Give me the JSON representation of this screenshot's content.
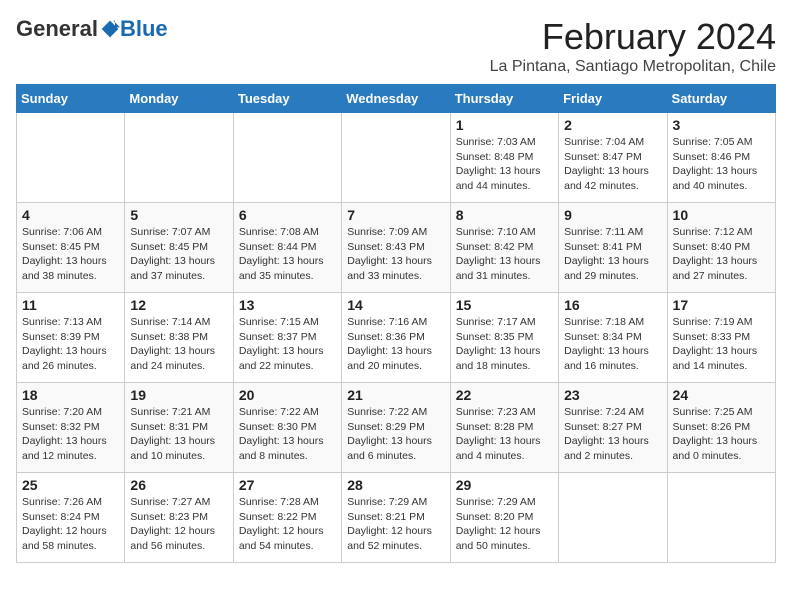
{
  "header": {
    "logo_general": "General",
    "logo_blue": "Blue",
    "title": "February 2024",
    "subtitle": "La Pintana, Santiago Metropolitan, Chile"
  },
  "weekdays": [
    "Sunday",
    "Monday",
    "Tuesday",
    "Wednesday",
    "Thursday",
    "Friday",
    "Saturday"
  ],
  "weeks": [
    [
      {
        "day": "",
        "info": ""
      },
      {
        "day": "",
        "info": ""
      },
      {
        "day": "",
        "info": ""
      },
      {
        "day": "",
        "info": ""
      },
      {
        "day": "1",
        "info": "Sunrise: 7:03 AM\nSunset: 8:48 PM\nDaylight: 13 hours and 44 minutes."
      },
      {
        "day": "2",
        "info": "Sunrise: 7:04 AM\nSunset: 8:47 PM\nDaylight: 13 hours and 42 minutes."
      },
      {
        "day": "3",
        "info": "Sunrise: 7:05 AM\nSunset: 8:46 PM\nDaylight: 13 hours and 40 minutes."
      }
    ],
    [
      {
        "day": "4",
        "info": "Sunrise: 7:06 AM\nSunset: 8:45 PM\nDaylight: 13 hours and 38 minutes."
      },
      {
        "day": "5",
        "info": "Sunrise: 7:07 AM\nSunset: 8:45 PM\nDaylight: 13 hours and 37 minutes."
      },
      {
        "day": "6",
        "info": "Sunrise: 7:08 AM\nSunset: 8:44 PM\nDaylight: 13 hours and 35 minutes."
      },
      {
        "day": "7",
        "info": "Sunrise: 7:09 AM\nSunset: 8:43 PM\nDaylight: 13 hours and 33 minutes."
      },
      {
        "day": "8",
        "info": "Sunrise: 7:10 AM\nSunset: 8:42 PM\nDaylight: 13 hours and 31 minutes."
      },
      {
        "day": "9",
        "info": "Sunrise: 7:11 AM\nSunset: 8:41 PM\nDaylight: 13 hours and 29 minutes."
      },
      {
        "day": "10",
        "info": "Sunrise: 7:12 AM\nSunset: 8:40 PM\nDaylight: 13 hours and 27 minutes."
      }
    ],
    [
      {
        "day": "11",
        "info": "Sunrise: 7:13 AM\nSunset: 8:39 PM\nDaylight: 13 hours and 26 minutes."
      },
      {
        "day": "12",
        "info": "Sunrise: 7:14 AM\nSunset: 8:38 PM\nDaylight: 13 hours and 24 minutes."
      },
      {
        "day": "13",
        "info": "Sunrise: 7:15 AM\nSunset: 8:37 PM\nDaylight: 13 hours and 22 minutes."
      },
      {
        "day": "14",
        "info": "Sunrise: 7:16 AM\nSunset: 8:36 PM\nDaylight: 13 hours and 20 minutes."
      },
      {
        "day": "15",
        "info": "Sunrise: 7:17 AM\nSunset: 8:35 PM\nDaylight: 13 hours and 18 minutes."
      },
      {
        "day": "16",
        "info": "Sunrise: 7:18 AM\nSunset: 8:34 PM\nDaylight: 13 hours and 16 minutes."
      },
      {
        "day": "17",
        "info": "Sunrise: 7:19 AM\nSunset: 8:33 PM\nDaylight: 13 hours and 14 minutes."
      }
    ],
    [
      {
        "day": "18",
        "info": "Sunrise: 7:20 AM\nSunset: 8:32 PM\nDaylight: 13 hours and 12 minutes."
      },
      {
        "day": "19",
        "info": "Sunrise: 7:21 AM\nSunset: 8:31 PM\nDaylight: 13 hours and 10 minutes."
      },
      {
        "day": "20",
        "info": "Sunrise: 7:22 AM\nSunset: 8:30 PM\nDaylight: 13 hours and 8 minutes."
      },
      {
        "day": "21",
        "info": "Sunrise: 7:22 AM\nSunset: 8:29 PM\nDaylight: 13 hours and 6 minutes."
      },
      {
        "day": "22",
        "info": "Sunrise: 7:23 AM\nSunset: 8:28 PM\nDaylight: 13 hours and 4 minutes."
      },
      {
        "day": "23",
        "info": "Sunrise: 7:24 AM\nSunset: 8:27 PM\nDaylight: 13 hours and 2 minutes."
      },
      {
        "day": "24",
        "info": "Sunrise: 7:25 AM\nSunset: 8:26 PM\nDaylight: 13 hours and 0 minutes."
      }
    ],
    [
      {
        "day": "25",
        "info": "Sunrise: 7:26 AM\nSunset: 8:24 PM\nDaylight: 12 hours and 58 minutes."
      },
      {
        "day": "26",
        "info": "Sunrise: 7:27 AM\nSunset: 8:23 PM\nDaylight: 12 hours and 56 minutes."
      },
      {
        "day": "27",
        "info": "Sunrise: 7:28 AM\nSunset: 8:22 PM\nDaylight: 12 hours and 54 minutes."
      },
      {
        "day": "28",
        "info": "Sunrise: 7:29 AM\nSunset: 8:21 PM\nDaylight: 12 hours and 52 minutes."
      },
      {
        "day": "29",
        "info": "Sunrise: 7:29 AM\nSunset: 8:20 PM\nDaylight: 12 hours and 50 minutes."
      },
      {
        "day": "",
        "info": ""
      },
      {
        "day": "",
        "info": ""
      }
    ]
  ]
}
